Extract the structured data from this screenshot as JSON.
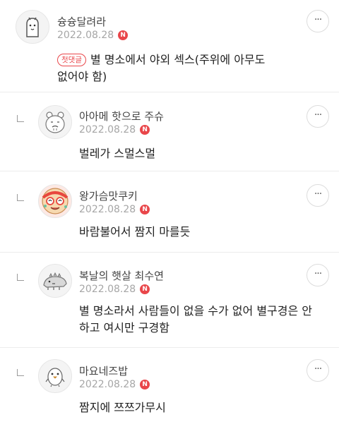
{
  "comments": [
    {
      "author": "슝슝달려라",
      "date": "2022.08.28",
      "new_badge": "N",
      "first_badge": "첫댓글",
      "text_line1": "별 명소에서 야외 섹스(주위에 아무도",
      "text_line2": "없어야 함)",
      "more_label": "···",
      "avatar_icon": "ghost-character-icon"
    },
    {
      "author": "아아메 핫으로 주슈",
      "date": "2022.08.28",
      "new_badge": "N",
      "text_line1": "벌레가 스멀스멀",
      "more_label": "···",
      "avatar_icon": "bear-character-icon"
    },
    {
      "author": "왕가슴맛쿠키",
      "date": "2022.08.28",
      "new_badge": "N",
      "text_line1": "바람불어서 짬지 마를듯",
      "more_label": "···",
      "avatar_icon": "cookie-character-icon"
    },
    {
      "author": "복날의 햇살 최수연",
      "date": "2022.08.28",
      "new_badge": "N",
      "text_line1": "별 명소라서 사람들이 없을 수가 없어 별구경은 안",
      "text_line2": "하고 여시만 구경함",
      "more_label": "···",
      "avatar_icon": "dinosaur-character-icon"
    },
    {
      "author": "마요네즈밥",
      "date": "2022.08.28",
      "new_badge": "N",
      "text_line1": "짬지에 쯔쯔가무시",
      "more_label": "···",
      "avatar_icon": "penguin-character-icon"
    }
  ]
}
